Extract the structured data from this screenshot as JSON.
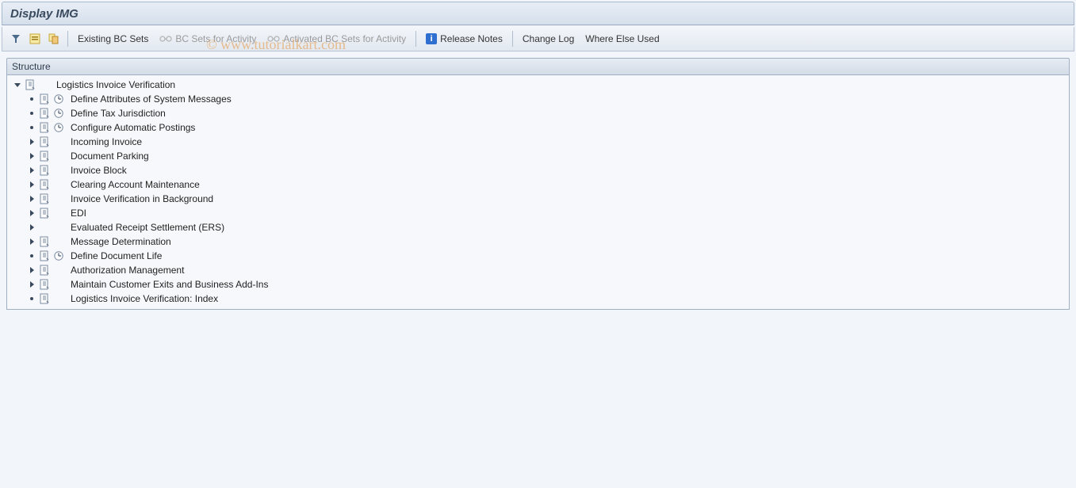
{
  "title": "Display IMG",
  "toolbar": {
    "existing_bc_sets": "Existing BC Sets",
    "bc_sets_for_activity": "BC Sets for Activity",
    "activated_bc_sets": "Activated BC Sets for Activity",
    "release_notes": "Release Notes",
    "change_log": "Change Log",
    "where_else_used": "Where Else Used"
  },
  "structure_header": "Structure",
  "watermark": "© www.tutorialkart.com",
  "tree": {
    "root": {
      "label": "Logistics Invoice Verification"
    },
    "items": [
      {
        "expander": "dot",
        "doc": true,
        "clock": true,
        "label": "Define Attributes of System Messages"
      },
      {
        "expander": "dot",
        "doc": true,
        "clock": true,
        "label": "Define Tax Jurisdiction"
      },
      {
        "expander": "dot",
        "doc": true,
        "clock": true,
        "label": "Configure Automatic Postings"
      },
      {
        "expander": "arrow",
        "doc": true,
        "clock": false,
        "label": "Incoming Invoice"
      },
      {
        "expander": "arrow",
        "doc": true,
        "clock": false,
        "label": "Document Parking"
      },
      {
        "expander": "arrow",
        "doc": true,
        "clock": false,
        "label": "Invoice Block"
      },
      {
        "expander": "arrow",
        "doc": true,
        "clock": false,
        "label": "Clearing Account Maintenance"
      },
      {
        "expander": "arrow",
        "doc": true,
        "clock": false,
        "label": "Invoice Verification in Background"
      },
      {
        "expander": "arrow",
        "doc": true,
        "clock": false,
        "label": "EDI"
      },
      {
        "expander": "arrow",
        "doc": false,
        "clock": false,
        "label": "Evaluated Receipt Settlement (ERS)"
      },
      {
        "expander": "arrow",
        "doc": true,
        "clock": false,
        "label": "Message Determination"
      },
      {
        "expander": "dot",
        "doc": true,
        "clock": true,
        "label": "Define Document Life"
      },
      {
        "expander": "arrow",
        "doc": true,
        "clock": false,
        "label": "Authorization Management"
      },
      {
        "expander": "arrow",
        "doc": true,
        "clock": false,
        "label": "Maintain Customer Exits and Business Add-Ins"
      },
      {
        "expander": "dot",
        "doc": true,
        "clock": false,
        "label": "Logistics Invoice Verification: Index"
      }
    ]
  }
}
